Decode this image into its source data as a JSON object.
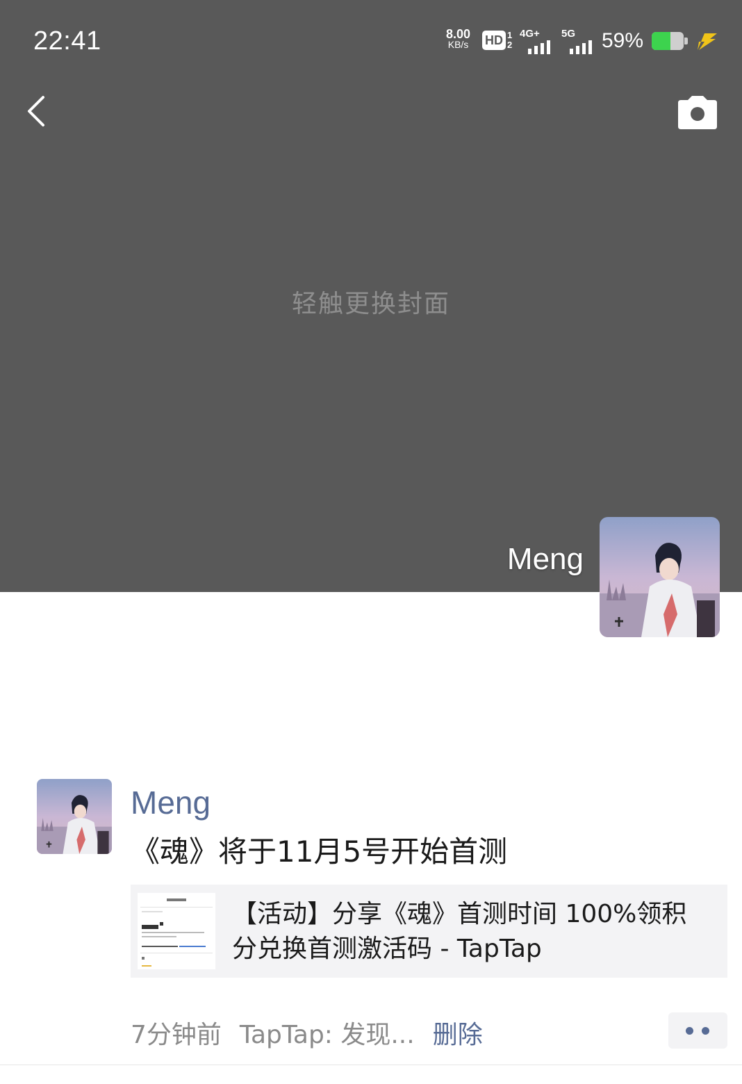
{
  "status_bar": {
    "time": "22:41",
    "net_speed_value": "8.00",
    "net_speed_unit": "KB/s",
    "hd_label": "HD",
    "hd_sim_1": "1",
    "hd_sim_2": "2",
    "network_1": "4G+",
    "network_2": "5G",
    "battery_percent": "59%",
    "battery_level": 0.59,
    "charging": true,
    "icons": [
      "hd-icon",
      "signal-4g-icon",
      "signal-5g-icon",
      "battery-icon",
      "charging-bolt-icon"
    ]
  },
  "header": {
    "back_icon": "chevron-left-icon",
    "camera_icon": "camera-icon"
  },
  "cover": {
    "hint": "轻触更换封面",
    "background_color": "#595959"
  },
  "profile": {
    "name": "Meng"
  },
  "post": {
    "author": "Meng",
    "text": "《魂》将于11月5号开始首测",
    "link": {
      "title": "【活动】分享《魂》首测时间 100%领积分兑换首测激活码 - TapTap"
    },
    "time": "7分钟前",
    "source": "TapTap: 发现...",
    "delete_label": "删除",
    "more_icon": "more-dots-icon"
  },
  "colors": {
    "link_blue": "#576b95",
    "muted_text": "#8a8a8a",
    "card_bg": "#f3f3f5",
    "battery_green": "#3dd34e"
  }
}
